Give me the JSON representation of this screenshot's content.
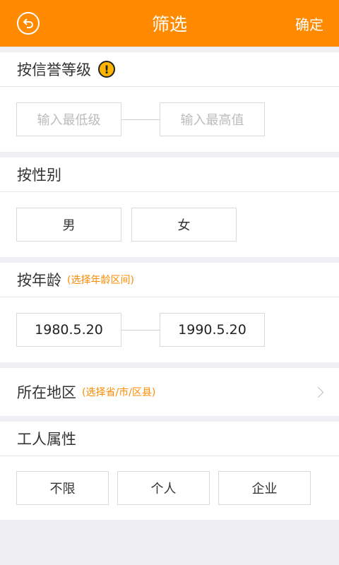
{
  "header": {
    "back_icon": "back-arrow-circle-icon",
    "title": "筛选",
    "confirm_label": "确定",
    "background": "#ff8a00"
  },
  "credit": {
    "title": "按信誉等级",
    "info_icon": "!",
    "min_placeholder": "输入最低级",
    "max_placeholder": "输入最高值"
  },
  "gender": {
    "title": "按性别",
    "options": [
      "男",
      "女"
    ]
  },
  "age": {
    "title": "按年龄",
    "hint": "(选择年龄区间)",
    "start": "1980.5.20",
    "end": "1990.5.20"
  },
  "region": {
    "title": "所在地区",
    "hint": "(选择省/市/区县)"
  },
  "worker_type": {
    "title": "工人属性",
    "options": [
      "不限",
      "个人",
      "企业"
    ]
  },
  "colors": {
    "accent": "#ff8a00",
    "background": "#efeff4"
  }
}
